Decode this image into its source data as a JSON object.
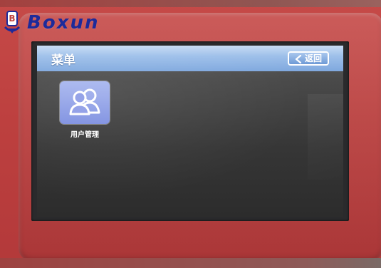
{
  "brand": {
    "logo_letter": "B",
    "name": "Boxun",
    "color": "#1d2a9a"
  },
  "device": {
    "casing_color": "#c0433f"
  },
  "screen": {
    "title": "菜单",
    "back_button_label": "返回",
    "back_icon": "chevron-left-icon",
    "title_bar_color": "#8fb4e4",
    "apps": [
      {
        "label": "用户管理",
        "icon": "users-icon",
        "tile_color": "#8d9ce6"
      }
    ]
  }
}
